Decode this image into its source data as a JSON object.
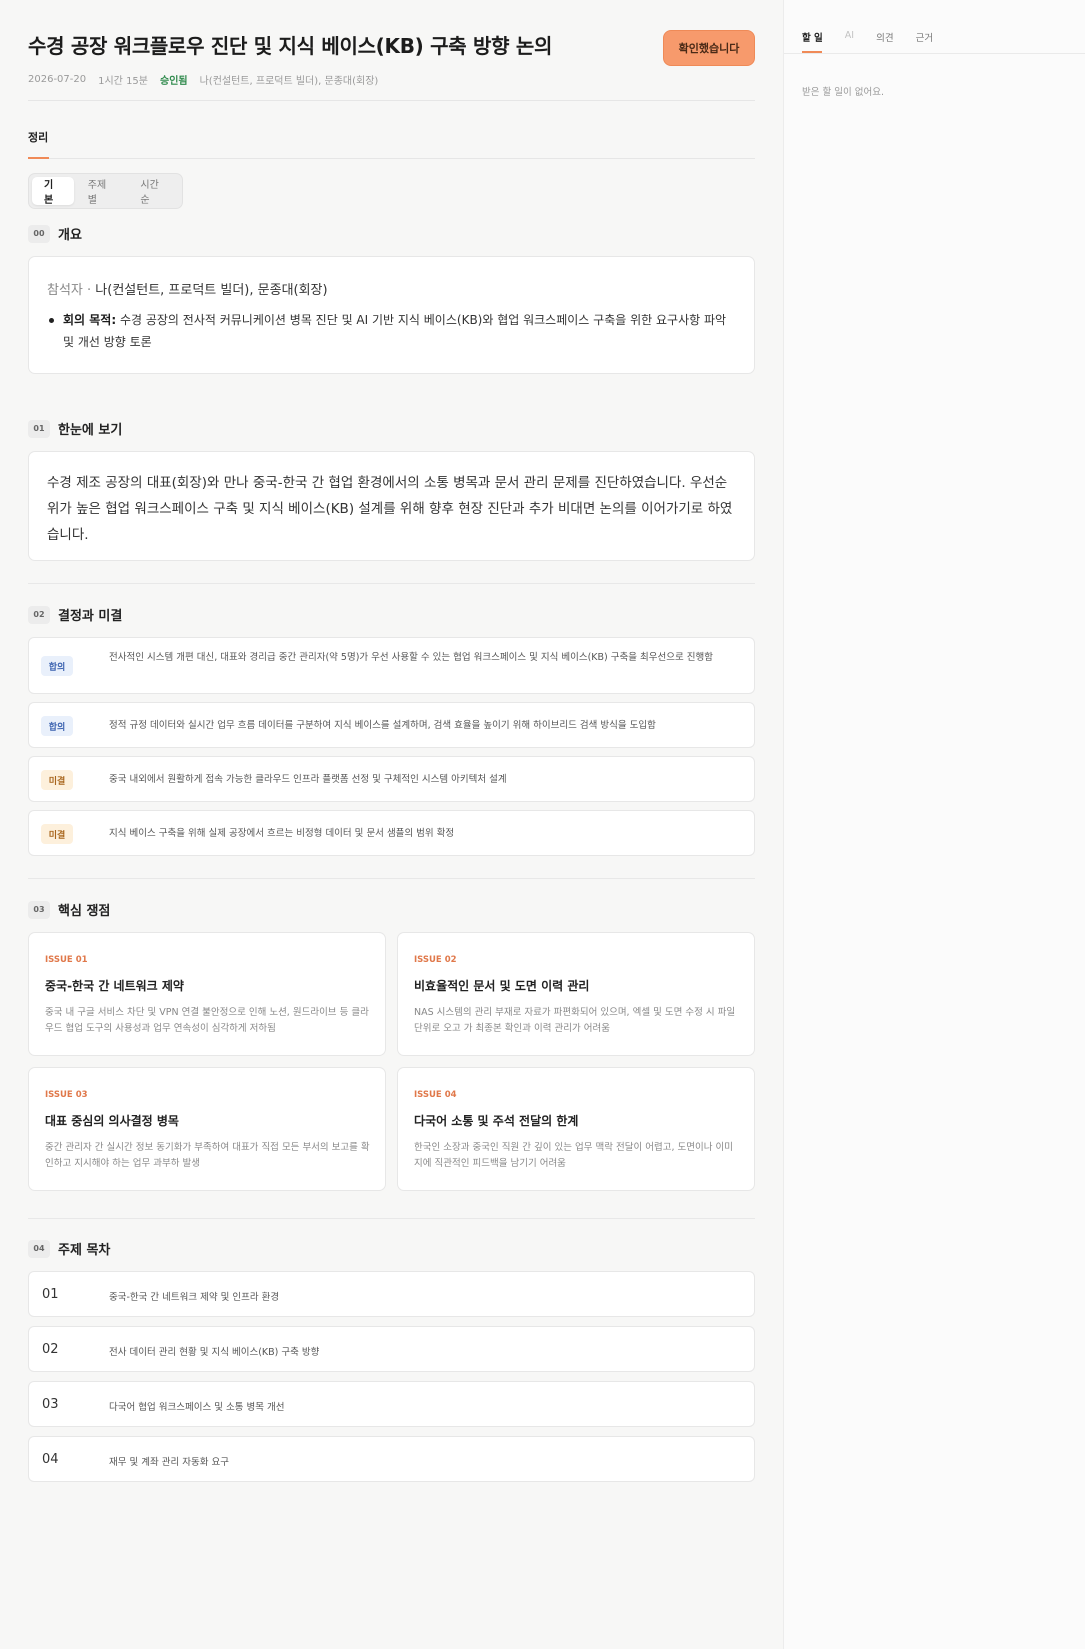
{
  "header": {
    "title": "수경 공장 워크플로우 진단 및 지식 베이스(KB) 구축 방향 논의",
    "date": "2026-07-20",
    "duration": "1시간 15분",
    "status": "승인됨",
    "participants": "나(컨설턴트, 프로덕트 빌더), 문종대(회장)",
    "confirm_label": "확인했습니다"
  },
  "tabs": {
    "summary": "정리"
  },
  "view_toggle": [
    "기본",
    "주제별",
    "시간순"
  ],
  "overview": {
    "num": "00",
    "title": "개요",
    "attendees_label": "참석자 · ",
    "attendees": "나(컨설턴트, 프로덕트 빌더), 문종대(회장)",
    "goal_label": "회의 목적:",
    "goal": " 수경 공장의 전사적 커뮤니케이션 병목 진단 및 AI 기반 지식 베이스(KB)와 협업 워크스페이스 구축을 위한 요구사항 파악 및 개선 방향 토론"
  },
  "glance": {
    "num": "01",
    "title": "한눈에 보기",
    "text": "수경 제조 공장의 대표(회장)와 만나 중국-한국 간 협업 환경에서의 소통 병목과 문서 관리 문제를 진단하였습니다. 우선순위가 높은 협업 워크스페이스 구축 및 지식 베이스(KB) 설계를 위해 향후 현장 진단과 추가 비대면 논의를 이어가기로 하였습니다."
  },
  "decisions": {
    "num": "02",
    "title": "결정과 미결",
    "items": [
      {
        "badge": "합의",
        "text": "전사적인 시스템 개편 대신, 대표와 경리급 중간 관리자(약 5명)가 우선 사용할 수 있는 협업 워크스페이스 및 지식 베이스(KB) 구축을 최우선으로 진행함"
      },
      {
        "badge": "합의",
        "text": "정적 규정 데이터와 실시간 업무 흐름 데이터를 구분하여 지식 베이스를 설계하며, 검색 효율을 높이기 위해 하이브리드 검색 방식을 도입함"
      },
      {
        "badge": "미결",
        "text": "중국 내외에서 원활하게 접속 가능한 클라우드 인프라 플랫폼 선정 및 구체적인 시스템 아키텍처 설계"
      },
      {
        "badge": "미결",
        "text": "지식 베이스 구축을 위해 실제 공장에서 흐르는 비정형 데이터 및 문서 샘플의 범위 확정"
      }
    ]
  },
  "issues": {
    "num": "03",
    "title": "핵심 쟁점",
    "items": [
      {
        "tag": "ISSUE 01",
        "title": "중국-한국 간 네트워크 제약",
        "desc": "중국 내 구글 서비스 차단 및 VPN 연결 불안정으로 인해 노션, 원드라이브 등 클라우드 협업 도구의 사용성과 업무 연속성이 심각하게 저하됨"
      },
      {
        "tag": "ISSUE 02",
        "title": "비효율적인 문서 및 도면 이력 관리",
        "desc": "NAS 시스템의 관리 부재로 자료가 파편화되어 있으며, 엑셀 및 도면 수정 시 파일 단위로 오고 가 최종본 확인과 이력 관리가 어려움"
      },
      {
        "tag": "ISSUE 03",
        "title": "대표 중심의 의사결정 병목",
        "desc": "중간 관리자 간 실시간 정보 동기화가 부족하여 대표가 직접 모든 부서의 보고를 확인하고 지시해야 하는 업무 과부하 발생"
      },
      {
        "tag": "ISSUE 04",
        "title": "다국어 소통 및 주석 전달의 한계",
        "desc": "한국인 소장과 중국인 직원 간 깊이 있는 업무 맥락 전달이 어렵고, 도면이나 이미지에 직관적인 피드백을 남기기 어려움"
      }
    ]
  },
  "toc": {
    "num": "04",
    "title": "주제 목차",
    "items": [
      {
        "num": "01",
        "text": "중국-한국 간 네트워크 제약 및 인프라 환경"
      },
      {
        "num": "02",
        "text": "전사 데이터 관리 현황 및 지식 베이스(KB) 구축 방향"
      },
      {
        "num": "03",
        "text": "다국어 협업 워크스페이스 및 소통 병목 개선"
      },
      {
        "num": "04",
        "text": "재무 및 계좌 관리 자동화 요구"
      }
    ]
  },
  "side": {
    "tabs": [
      "할 일",
      "AI",
      "의견",
      "근거"
    ],
    "empty": "받은 할 일이 없어요."
  },
  "colors": {
    "accent": "#f08a57",
    "button": "#f79a6c"
  }
}
